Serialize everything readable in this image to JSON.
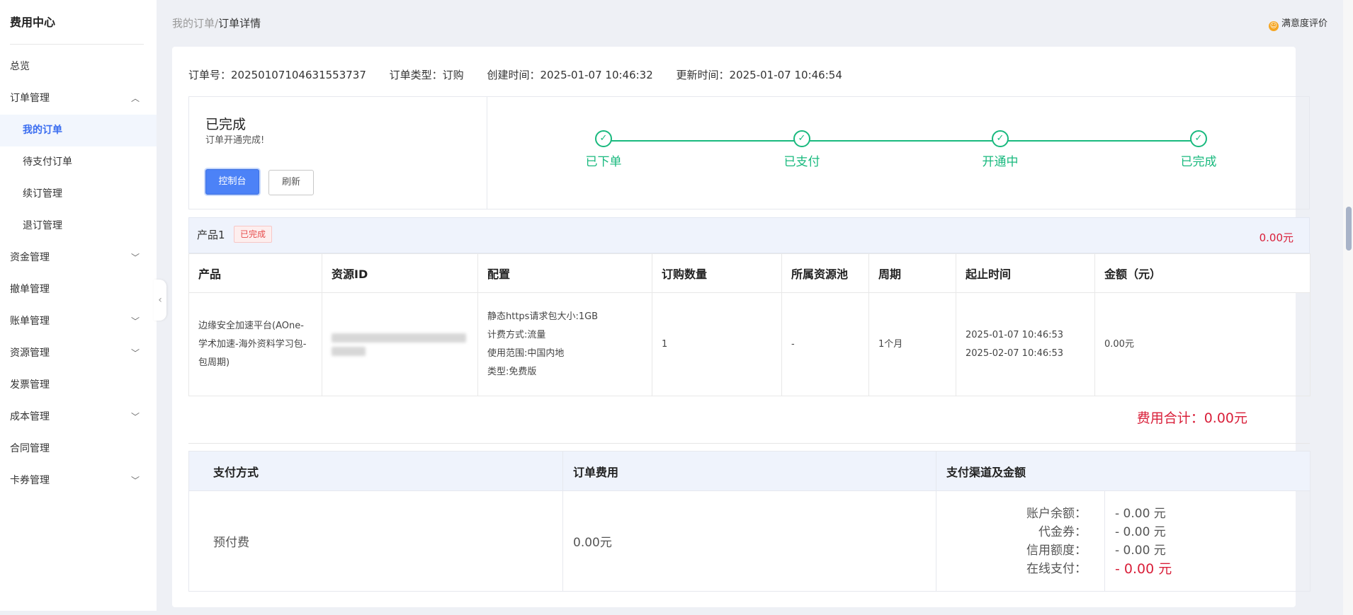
{
  "sidebar": {
    "title": "费用中心",
    "items": [
      {
        "label": "总览",
        "sub": false,
        "active": false,
        "chevron": ""
      },
      {
        "label": "订单管理",
        "sub": false,
        "active": false,
        "chevron": "up"
      },
      {
        "label": "我的订单",
        "sub": true,
        "active": true,
        "chevron": ""
      },
      {
        "label": "待支付订单",
        "sub": true,
        "active": false,
        "chevron": ""
      },
      {
        "label": "续订管理",
        "sub": true,
        "active": false,
        "chevron": ""
      },
      {
        "label": "退订管理",
        "sub": true,
        "active": false,
        "chevron": ""
      },
      {
        "label": "资金管理",
        "sub": false,
        "active": false,
        "chevron": "down"
      },
      {
        "label": "撤单管理",
        "sub": false,
        "active": false,
        "chevron": ""
      },
      {
        "label": "账单管理",
        "sub": false,
        "active": false,
        "chevron": "down"
      },
      {
        "label": "资源管理",
        "sub": false,
        "active": false,
        "chevron": "down"
      },
      {
        "label": "发票管理",
        "sub": false,
        "active": false,
        "chevron": ""
      },
      {
        "label": "成本管理",
        "sub": false,
        "active": false,
        "chevron": "down"
      },
      {
        "label": "合同管理",
        "sub": false,
        "active": false,
        "chevron": ""
      },
      {
        "label": "卡券管理",
        "sub": false,
        "active": false,
        "chevron": "down"
      }
    ]
  },
  "breadcrumb": {
    "parent": "我的订单",
    "separator": "/",
    "current": "订单详情"
  },
  "rating_label": "满意度评价",
  "order_meta": {
    "order_no": "订单号：2025010710463155​3737",
    "order_type": "订单类型：订购",
    "created": "创建时间：2025-01-07 10:46:32",
    "updated": "更新时间：2025-01-07 10:46:54"
  },
  "status": {
    "title": "已完成",
    "subtitle": "订单开通完成!",
    "console_button": "控制台",
    "refresh_button": "刷新"
  },
  "steps": [
    "已下单",
    "已支付",
    "开通中",
    "已完成"
  ],
  "product": {
    "name": "产品1",
    "badge": "已完成",
    "amount": "0.00元",
    "headers": [
      "产品",
      "资源ID",
      "配置",
      "订购数量",
      "所属资源池",
      "周期",
      "起止时间",
      "金额（元）"
    ],
    "row": {
      "product": "边缘安全加速平台(AOne-学术加速-海外资料学习包-包周期)",
      "config": [
        "静态https请求包大小:1GB",
        "计费方式:流量",
        "使用范围:中国内地",
        "类型:免费版"
      ],
      "quantity": "1",
      "pool": "-",
      "period": "1个月",
      "start": "2025-01-07 10:46:53",
      "end": "2025-02-07 10:46:53",
      "amount": "0.00元"
    }
  },
  "total": "费用合计：0.00元",
  "payment": {
    "headers": [
      "支付方式",
      "订单费用",
      "支付渠道及金额"
    ],
    "method": "预付费",
    "order_fee": "0.00元",
    "channels": [
      {
        "label": "账户余额：",
        "value": "- 0.00 元"
      },
      {
        "label": "代金券：",
        "value": "- 0.00 元"
      },
      {
        "label": "信用额度：",
        "value": "- 0.00 元"
      },
      {
        "label": "在线支付：",
        "value": "- 0.00 元"
      }
    ]
  },
  "colors": {
    "accent": "#4c82f7",
    "success": "#19b97e",
    "danger": "#d9203a"
  }
}
